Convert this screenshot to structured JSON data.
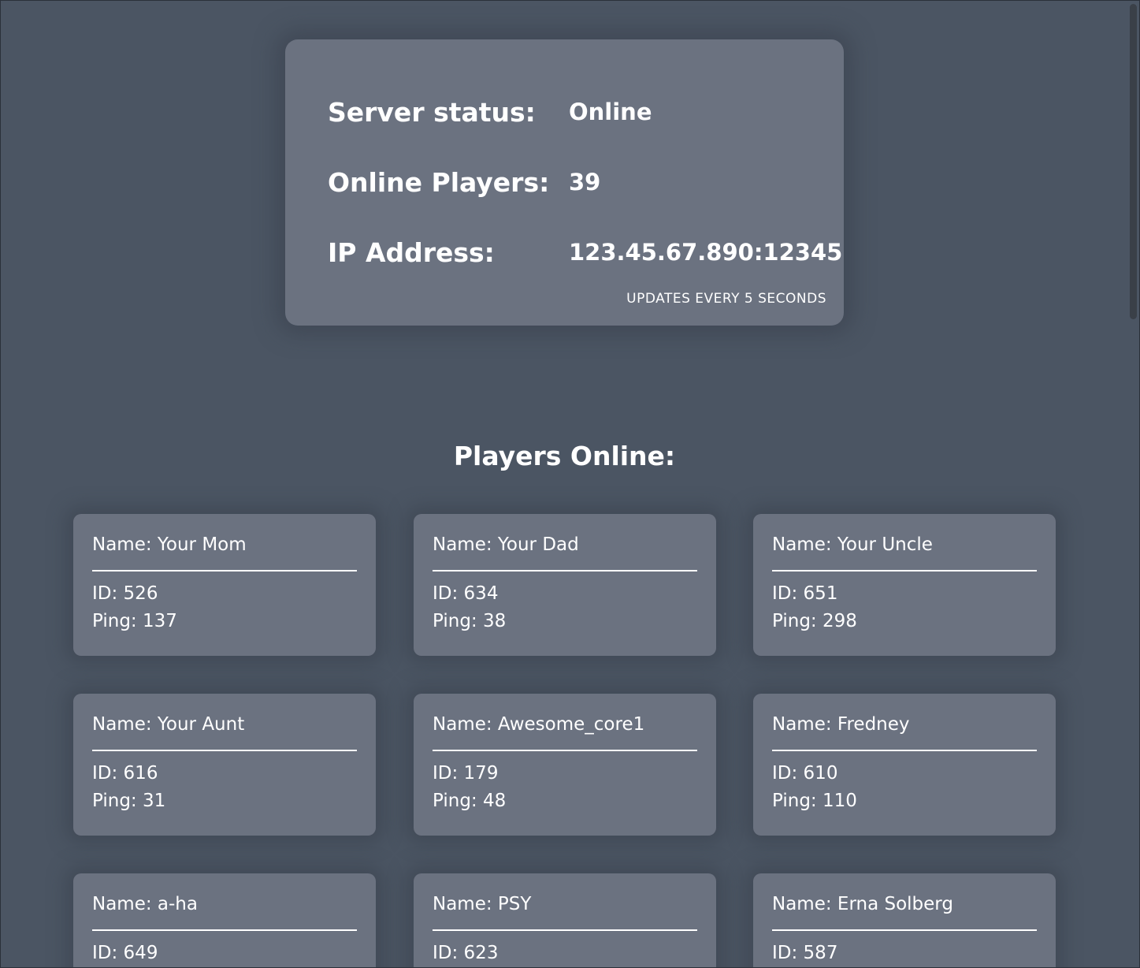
{
  "status": {
    "server_status_label": "Server status:",
    "server_status_value": "Online",
    "online_players_label": "Online Players:",
    "online_players_value": "39",
    "ip_label": "IP Address:",
    "ip_value": "123.45.67.890:12345",
    "updates_note": "UPDATES EVERY 5 SECONDS"
  },
  "players_heading": "Players Online:",
  "players": [
    {
      "name": "Name: Your Mom",
      "id": "ID: 526",
      "ping": "Ping: 137"
    },
    {
      "name": "Name: Your Dad",
      "id": "ID: 634",
      "ping": "Ping: 38"
    },
    {
      "name": "Name: Your Uncle",
      "id": "ID: 651",
      "ping": "Ping: 298"
    },
    {
      "name": "Name: Your Aunt",
      "id": "ID: 616",
      "ping": "Ping: 31"
    },
    {
      "name": "Name: Awesome_core1",
      "id": "ID: 179",
      "ping": "Ping: 48"
    },
    {
      "name": "Name: Fredney",
      "id": "ID: 610",
      "ping": "Ping: 110"
    },
    {
      "name": "Name: a-ha",
      "id": "ID: 649",
      "ping": ""
    },
    {
      "name": "Name: PSY",
      "id": "ID: 623",
      "ping": ""
    },
    {
      "name": "Name: Erna Solberg",
      "id": "ID: 587",
      "ping": ""
    }
  ],
  "colors": {
    "background": "#4b5563",
    "card": "#6b7280",
    "text": "#ffffff"
  }
}
